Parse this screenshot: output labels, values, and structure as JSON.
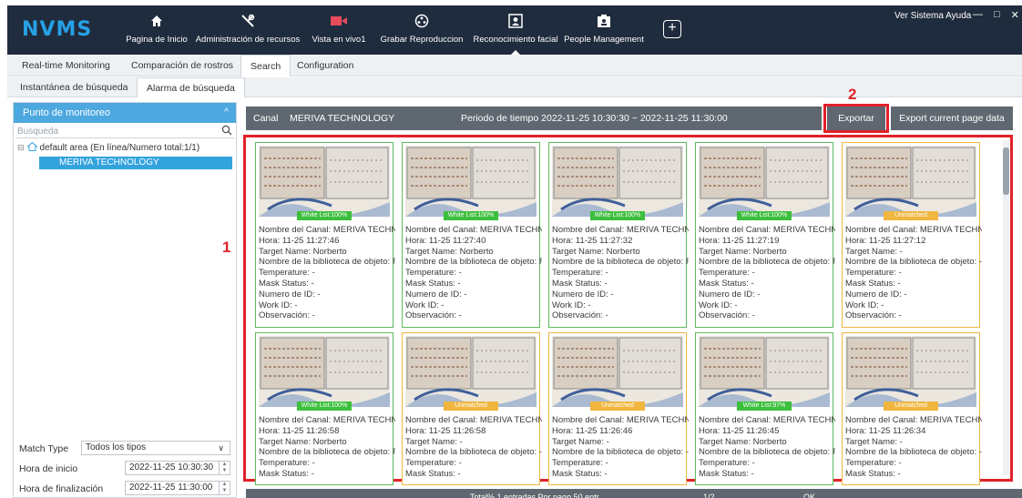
{
  "app": {
    "logo": "NVMS",
    "sys_menu": "Ver  Sistema  Ayuda",
    "win_buttons": {
      "min": "—",
      "max": "□",
      "close": "✕"
    }
  },
  "nav": [
    {
      "id": "inicio",
      "label": "Pagina de Inicio",
      "icon": "home-icon"
    },
    {
      "id": "recursos",
      "label": "Administración de recursos",
      "icon": "tools-icon"
    },
    {
      "id": "vivo",
      "label": "Vista en vivo1",
      "icon": "camera-icon"
    },
    {
      "id": "grabar",
      "label": "Grabar Reproduccion",
      "icon": "reel-icon"
    },
    {
      "id": "facial",
      "label": "Reconocimiento facial",
      "icon": "face-scan-icon",
      "active": true
    },
    {
      "id": "people",
      "label": "People Management",
      "icon": "badge-icon"
    }
  ],
  "tabs1": [
    "Real-time Monitoring",
    "Comparación de rostros",
    "Search",
    "Configuration"
  ],
  "tabs2": [
    "Instantánea de búsqueda",
    "Alarma de búsqueda"
  ],
  "left": {
    "header": "Punto de monitoreo",
    "search_placeholder": "Busqueda",
    "tree_root": "default area (En línea/Numero total:1/1)",
    "tree_child": "MERIVA TECHNOLOGY",
    "match_type_label": "Match Type",
    "match_type_value": "Todos los tipos",
    "start_label": "Hora de inicio",
    "start_value": "2022-11-25 10:30:30",
    "end_label": "Hora de finalización",
    "end_value": "2022-11-25 11:30:00"
  },
  "info": {
    "canal_label": "Canal",
    "canal_value": "MERIVA TECHNOLOGY",
    "periodo": "Periodo de tiempo  2022-11-25 10:30:30  ~  2022-11-25 11:30:00",
    "export": "Exportar",
    "export_page": "Export current page data"
  },
  "annotations": {
    "grid": "1",
    "export": "2"
  },
  "cards": [
    {
      "tag": "White List:100%",
      "matched": true,
      "lines": [
        "Nombre del Canal: MERIVA TECHNO",
        "Hora: 11-25 11:27:46",
        "Target Name: Norberto",
        "Nombre de la biblioteca de objeto: F",
        "Temperature: -",
        "Mask Status: -",
        "Numero de ID: -",
        "Work ID: -",
        "Observación: -"
      ]
    },
    {
      "tag": "White List:100%",
      "matched": true,
      "lines": [
        "Nombre del Canal: MERIVA TECHNO",
        "Hora: 11-25 11:27:40",
        "Target Name: Norberto",
        "Nombre de la biblioteca de objeto: F",
        "Temperature: -",
        "Mask Status: -",
        "Numero de ID: -",
        "Work ID: -",
        "Observación: -"
      ]
    },
    {
      "tag": "White List:100%",
      "matched": true,
      "lines": [
        "Nombre del Canal: MERIVA TECHNO",
        "Hora: 11-25 11:27:32",
        "Target Name: Norberto",
        "Nombre de la biblioteca de objeto: F",
        "Temperature: -",
        "Mask Status: -",
        "Numero de ID: -",
        "Work ID: -",
        "Observación: -"
      ]
    },
    {
      "tag": "White List:100%",
      "matched": true,
      "lines": [
        "Nombre del Canal: MERIVA TECHNO",
        "Hora: 11-25 11:27:19",
        "Target Name: Norberto",
        "Nombre de la biblioteca de objeto: F",
        "Temperature: -",
        "Mask Status: -",
        "Numero de ID: -",
        "Work ID: -",
        "Observación: -"
      ]
    },
    {
      "tag": "Unmatched",
      "matched": false,
      "lines": [
        "Nombre del Canal: MERIVA TECHNO",
        "Hora: 11-25 11:27:12",
        "Target Name: -",
        "Nombre de la biblioteca de objeto: -",
        "Temperature: -",
        "Mask Status: -",
        "Numero de ID: -",
        "Work ID: -",
        "Observación: -"
      ]
    },
    {
      "tag": "White List:100%",
      "matched": true,
      "lines": [
        "Nombre del Canal: MERIVA TECHNO",
        "Hora: 11-25 11:26:58",
        "Target Name: Norberto",
        "Nombre de la biblioteca de objeto: F",
        "Temperature: -",
        "Mask Status: -"
      ]
    },
    {
      "tag": "Unmatched",
      "matched": false,
      "lines": [
        "Nombre del Canal: MERIVA TECHNO",
        "Hora: 11-25 11:26:58",
        "Target Name: -",
        "Nombre de la biblioteca de objeto: -",
        "Temperature: -",
        "Mask Status: -"
      ]
    },
    {
      "tag": "Unmatched",
      "matched": false,
      "lines": [
        "Nombre del Canal: MERIVA TECHNO",
        "Hora: 11-25 11:26:46",
        "Target Name: -",
        "Nombre de la biblioteca de objeto: -",
        "Temperature: -",
        "Mask Status: -"
      ]
    },
    {
      "tag": "White List:97%",
      "matched": true,
      "lines": [
        "Nombre del Canal: MERIVA TECHNO",
        "Hora: 11-25 11:26:45",
        "Target Name: Norberto",
        "Nombre de la biblioteca de objeto: F",
        "Temperature: -",
        "Mask Status: -"
      ]
    },
    {
      "tag": "Unmatched",
      "matched": false,
      "lines": [
        "Nombre del Canal: MERIVA TECHNO",
        "Hora: 11-25 11:26:34",
        "Target Name: -",
        "Nombre de la biblioteca de objeto: -",
        "Temperature: -",
        "Mask Status: -"
      ]
    }
  ],
  "pagebar": {
    "summary": "Total% 1 entradas  Por pago 50 entr",
    "page": "1/2",
    "ok": "OK"
  },
  "colors": {
    "topbar": "#1f2c3d",
    "accent": "#33a3de",
    "highlight": "#e0212a",
    "matched": "#3cbf3c",
    "unmatched": "#f0b640",
    "infobar": "#5f6870"
  }
}
